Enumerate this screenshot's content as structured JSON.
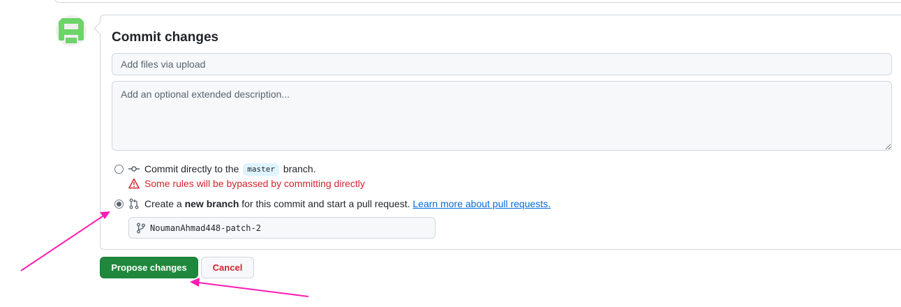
{
  "commit": {
    "title": "Commit changes",
    "summary_placeholder": "Add files via upload",
    "summary_value": "",
    "description_placeholder": "Add an optional extended description...",
    "description_value": ""
  },
  "options": {
    "direct": {
      "prefix": "Commit directly to the",
      "branch": "master",
      "suffix": "branch.",
      "selected": false,
      "warning": "Some rules will be bypassed by committing directly"
    },
    "new_branch": {
      "prefix": "Create a",
      "emphasis": "new branch",
      "suffix": "for this commit and start a pull request.",
      "link": "Learn more about pull requests.",
      "selected": true,
      "branch_name": "NoumanAhmad448-patch-2"
    }
  },
  "actions": {
    "propose_label": "Propose changes",
    "cancel_label": "Cancel"
  },
  "colors": {
    "primary": "#1f883d",
    "danger": "#d1242f",
    "link": "#0969da",
    "annotation_arrow": "#ff1ab3",
    "avatar": "#6cd468"
  },
  "icons": {
    "avatar": "identicon-avatar",
    "commit": "git-commit-icon",
    "warning": "alert-triangle-icon",
    "pull_request": "git-pull-request-icon",
    "branch": "git-branch-icon"
  }
}
